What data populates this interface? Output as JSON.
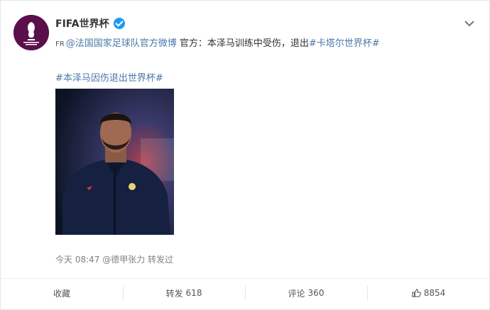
{
  "post": {
    "username": "FIFA世界杯",
    "line1": {
      "fr": "FR",
      "mention": "@法国国家足球队官方微博",
      "text": " 官方：本泽马训练中受伤，退出",
      "tag": "#卡塔尔世界杯#"
    },
    "hashtag": "#本泽马因伤退出世界杯#",
    "meta": "今天 08:47 @德甲张力 转发过"
  },
  "actions": {
    "favorite": "收藏",
    "repost_label": "转发",
    "repost_count": "618",
    "comment_label": "评论",
    "comment_count": "360",
    "like_count": "8854"
  },
  "icons": {
    "avatar": "fifa-world-cup-logo",
    "verified": "verified-badge-icon",
    "menu": "chevron-down-icon",
    "like": "thumbs-up-icon"
  },
  "colors": {
    "link": "#4a78a8",
    "verified": "#1d9bf0",
    "avatar_bg": "#5b0f4a"
  }
}
